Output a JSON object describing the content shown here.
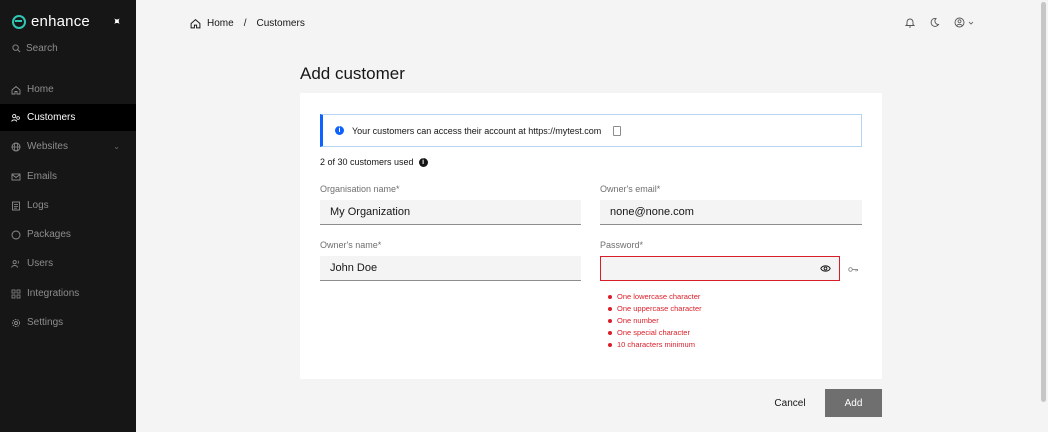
{
  "brand": {
    "name": "enhance",
    "accent": "#30c7b5"
  },
  "sidebar": {
    "search_label": "Search",
    "items": [
      {
        "label": "Home",
        "icon": "home-icon"
      },
      {
        "label": "Customers",
        "icon": "customers-icon",
        "active": true
      },
      {
        "label": "Websites",
        "icon": "globe-icon",
        "chevron": "⌄"
      },
      {
        "label": "Emails",
        "icon": "mail-icon"
      },
      {
        "label": "Logs",
        "icon": "logs-icon"
      },
      {
        "label": "Packages",
        "icon": "package-icon"
      },
      {
        "label": "Users",
        "icon": "users-icon"
      },
      {
        "label": "Integrations",
        "icon": "integrations-icon"
      },
      {
        "label": "Settings",
        "icon": "gear-icon"
      }
    ]
  },
  "breadcrumb": {
    "home": "Home",
    "separator": "/",
    "current": "Customers"
  },
  "page": {
    "title": "Add customer"
  },
  "notice": {
    "text": "Your customers can access their account at https://mytest.com"
  },
  "usage": {
    "text": "2 of 30 customers used"
  },
  "form": {
    "org_name": {
      "label": "Organisation name*",
      "value": "My Organization"
    },
    "owner_email": {
      "label": "Owner's email*",
      "value": "none@none.com"
    },
    "owner_name": {
      "label": "Owner's name*",
      "value": "John Doe"
    },
    "password": {
      "label": "Password*",
      "value": ""
    },
    "password_rules": [
      "One lowercase character",
      "One uppercase character",
      "One number",
      "One special character",
      "10 characters minimum"
    ]
  },
  "actions": {
    "cancel": "Cancel",
    "add": "Add"
  },
  "colors": {
    "error": "#da1e28",
    "info": "#0f62fe",
    "sidebar_bg": "#161616"
  }
}
